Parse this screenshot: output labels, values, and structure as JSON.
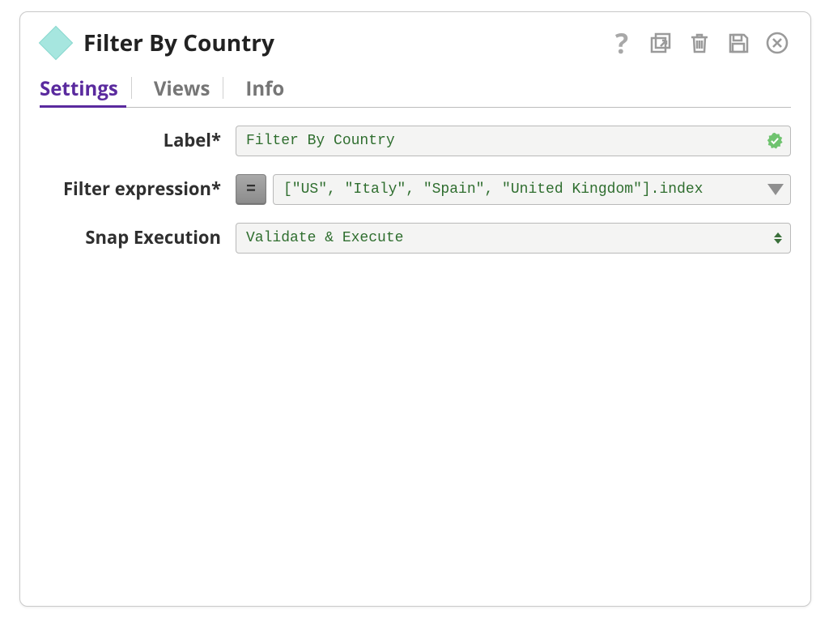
{
  "header": {
    "title": "Filter By Country"
  },
  "tabs": [
    {
      "label": "Settings",
      "active": true
    },
    {
      "label": "Views",
      "active": false
    },
    {
      "label": "Info",
      "active": false
    }
  ],
  "form": {
    "label_field": {
      "label": "Label*",
      "value": "Filter By Country"
    },
    "filter_expression": {
      "label": "Filter expression*",
      "eq_button": "=",
      "value": "[\"US\", \"Italy\", \"Spain\", \"United Kingdom\"].index"
    },
    "snap_execution": {
      "label": "Snap Execution",
      "value": "Validate & Execute"
    }
  },
  "icons": {
    "help": "?",
    "popout": "popout-icon",
    "delete": "trash-icon",
    "save": "save-icon",
    "close": "close-icon"
  }
}
